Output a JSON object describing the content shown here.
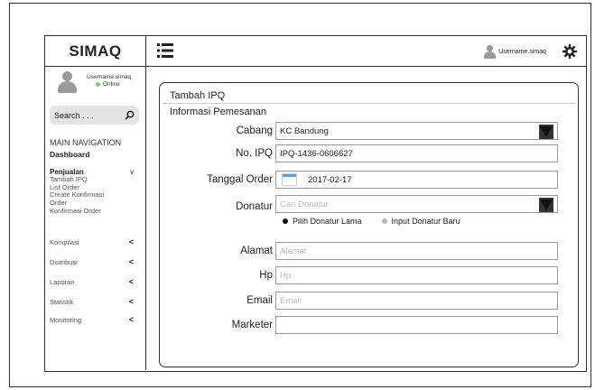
{
  "app": {
    "title": "SIMAQ"
  },
  "user": {
    "name": "Username.simaq",
    "status": "Online"
  },
  "search": {
    "placeholder": "Search . . ."
  },
  "nav": {
    "heading": "MAIN NAVIGATION",
    "dashboard": "Dashboard",
    "penjualan": {
      "label": "Penjualan",
      "caret": "v",
      "items": [
        "Tambah IPQ",
        "List Order",
        "Create Konfirmasi",
        "Order",
        "Konfirmasi Order"
      ]
    },
    "menu": [
      {
        "label": "Kompilasi",
        "caret": "<"
      },
      {
        "label": "Distribusi",
        "caret": "<"
      },
      {
        "label": "Laporan",
        "caret": "<"
      },
      {
        "label": "Statistik",
        "caret": "<"
      },
      {
        "label": "Monitoring",
        "caret": "<"
      }
    ]
  },
  "topbar": {
    "username": "Username.simaq"
  },
  "form": {
    "title": "Tambah IPQ",
    "section": "Informasi Pemesanan",
    "cabang": {
      "label": "Cabang",
      "value": "KC Bandung"
    },
    "no_ipq": {
      "label": "No. IPQ",
      "value": "IPQ-1436-0606627"
    },
    "tanggal": {
      "label": "Tanggal Order",
      "value": "2017-02-17"
    },
    "donatur": {
      "label": "Donatur",
      "placeholder": "Cari Donatur",
      "option_lama": "Pilih Donatur Lama",
      "option_baru": "Input Donatur Baru"
    },
    "alamat": {
      "label": "Alamat",
      "placeholder": "Alamat"
    },
    "hp": {
      "label": "Hp",
      "placeholder": "Hp"
    },
    "email": {
      "label": "Email",
      "placeholder": "Email"
    },
    "marketer": {
      "label": "Marketer",
      "value": ""
    }
  },
  "colors": {
    "status_online": "#7cc97c",
    "calendar_accent": "#5aa0e6",
    "avatar": "#9a9a9a"
  },
  "icons": [
    "menu-icon",
    "user-icon",
    "gear-icon",
    "search-icon",
    "dropdown-arrow-icon",
    "calendar-icon"
  ]
}
